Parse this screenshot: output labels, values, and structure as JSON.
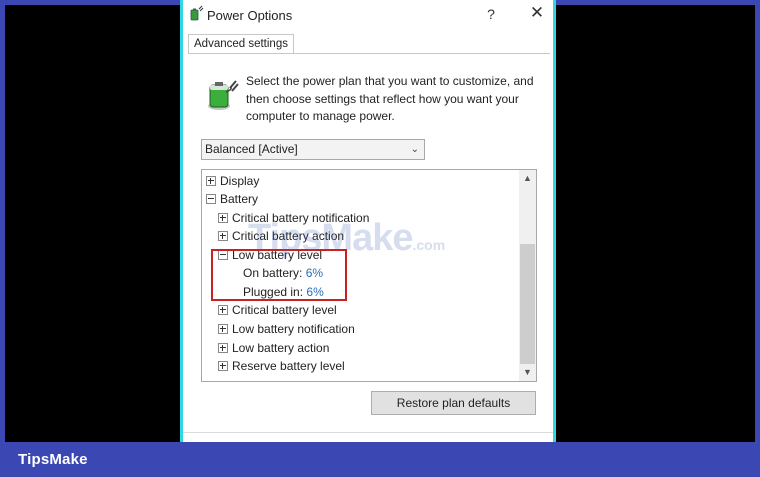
{
  "window": {
    "title": "Power Options",
    "help": "?",
    "close": "✕"
  },
  "tab": {
    "label": "Advanced settings"
  },
  "intro": "Select the power plan that you want to customize, and then choose settings that reflect how you want your computer to manage power.",
  "plan_select": {
    "value": "Balanced [Active]",
    "chevron": "⌄"
  },
  "tree": {
    "display": "Display",
    "battery": "Battery",
    "critical_notification": "Critical battery notification",
    "critical_action": "Critical battery action",
    "low_level": "Low battery level",
    "on_battery_label": "On battery:",
    "on_battery_value": "6%",
    "plugged_in_label": "Plugged in:",
    "plugged_in_value": "6%",
    "critical_level": "Critical battery level",
    "low_notification": "Low battery notification",
    "low_action": "Low battery action",
    "reserve_level": "Reserve battery level"
  },
  "buttons": {
    "restore": "Restore plan defaults"
  },
  "brand": "TipsMake",
  "watermark": {
    "main": "TipsMake",
    "sub": ".com"
  },
  "colors": {
    "frame": "#3b48b3",
    "window_border": "#2fd6e6",
    "highlight": "#c82124",
    "value_text": "#2a6ebb"
  },
  "icons": {
    "title": "power-options-icon",
    "battery": "battery-plug-icon"
  }
}
